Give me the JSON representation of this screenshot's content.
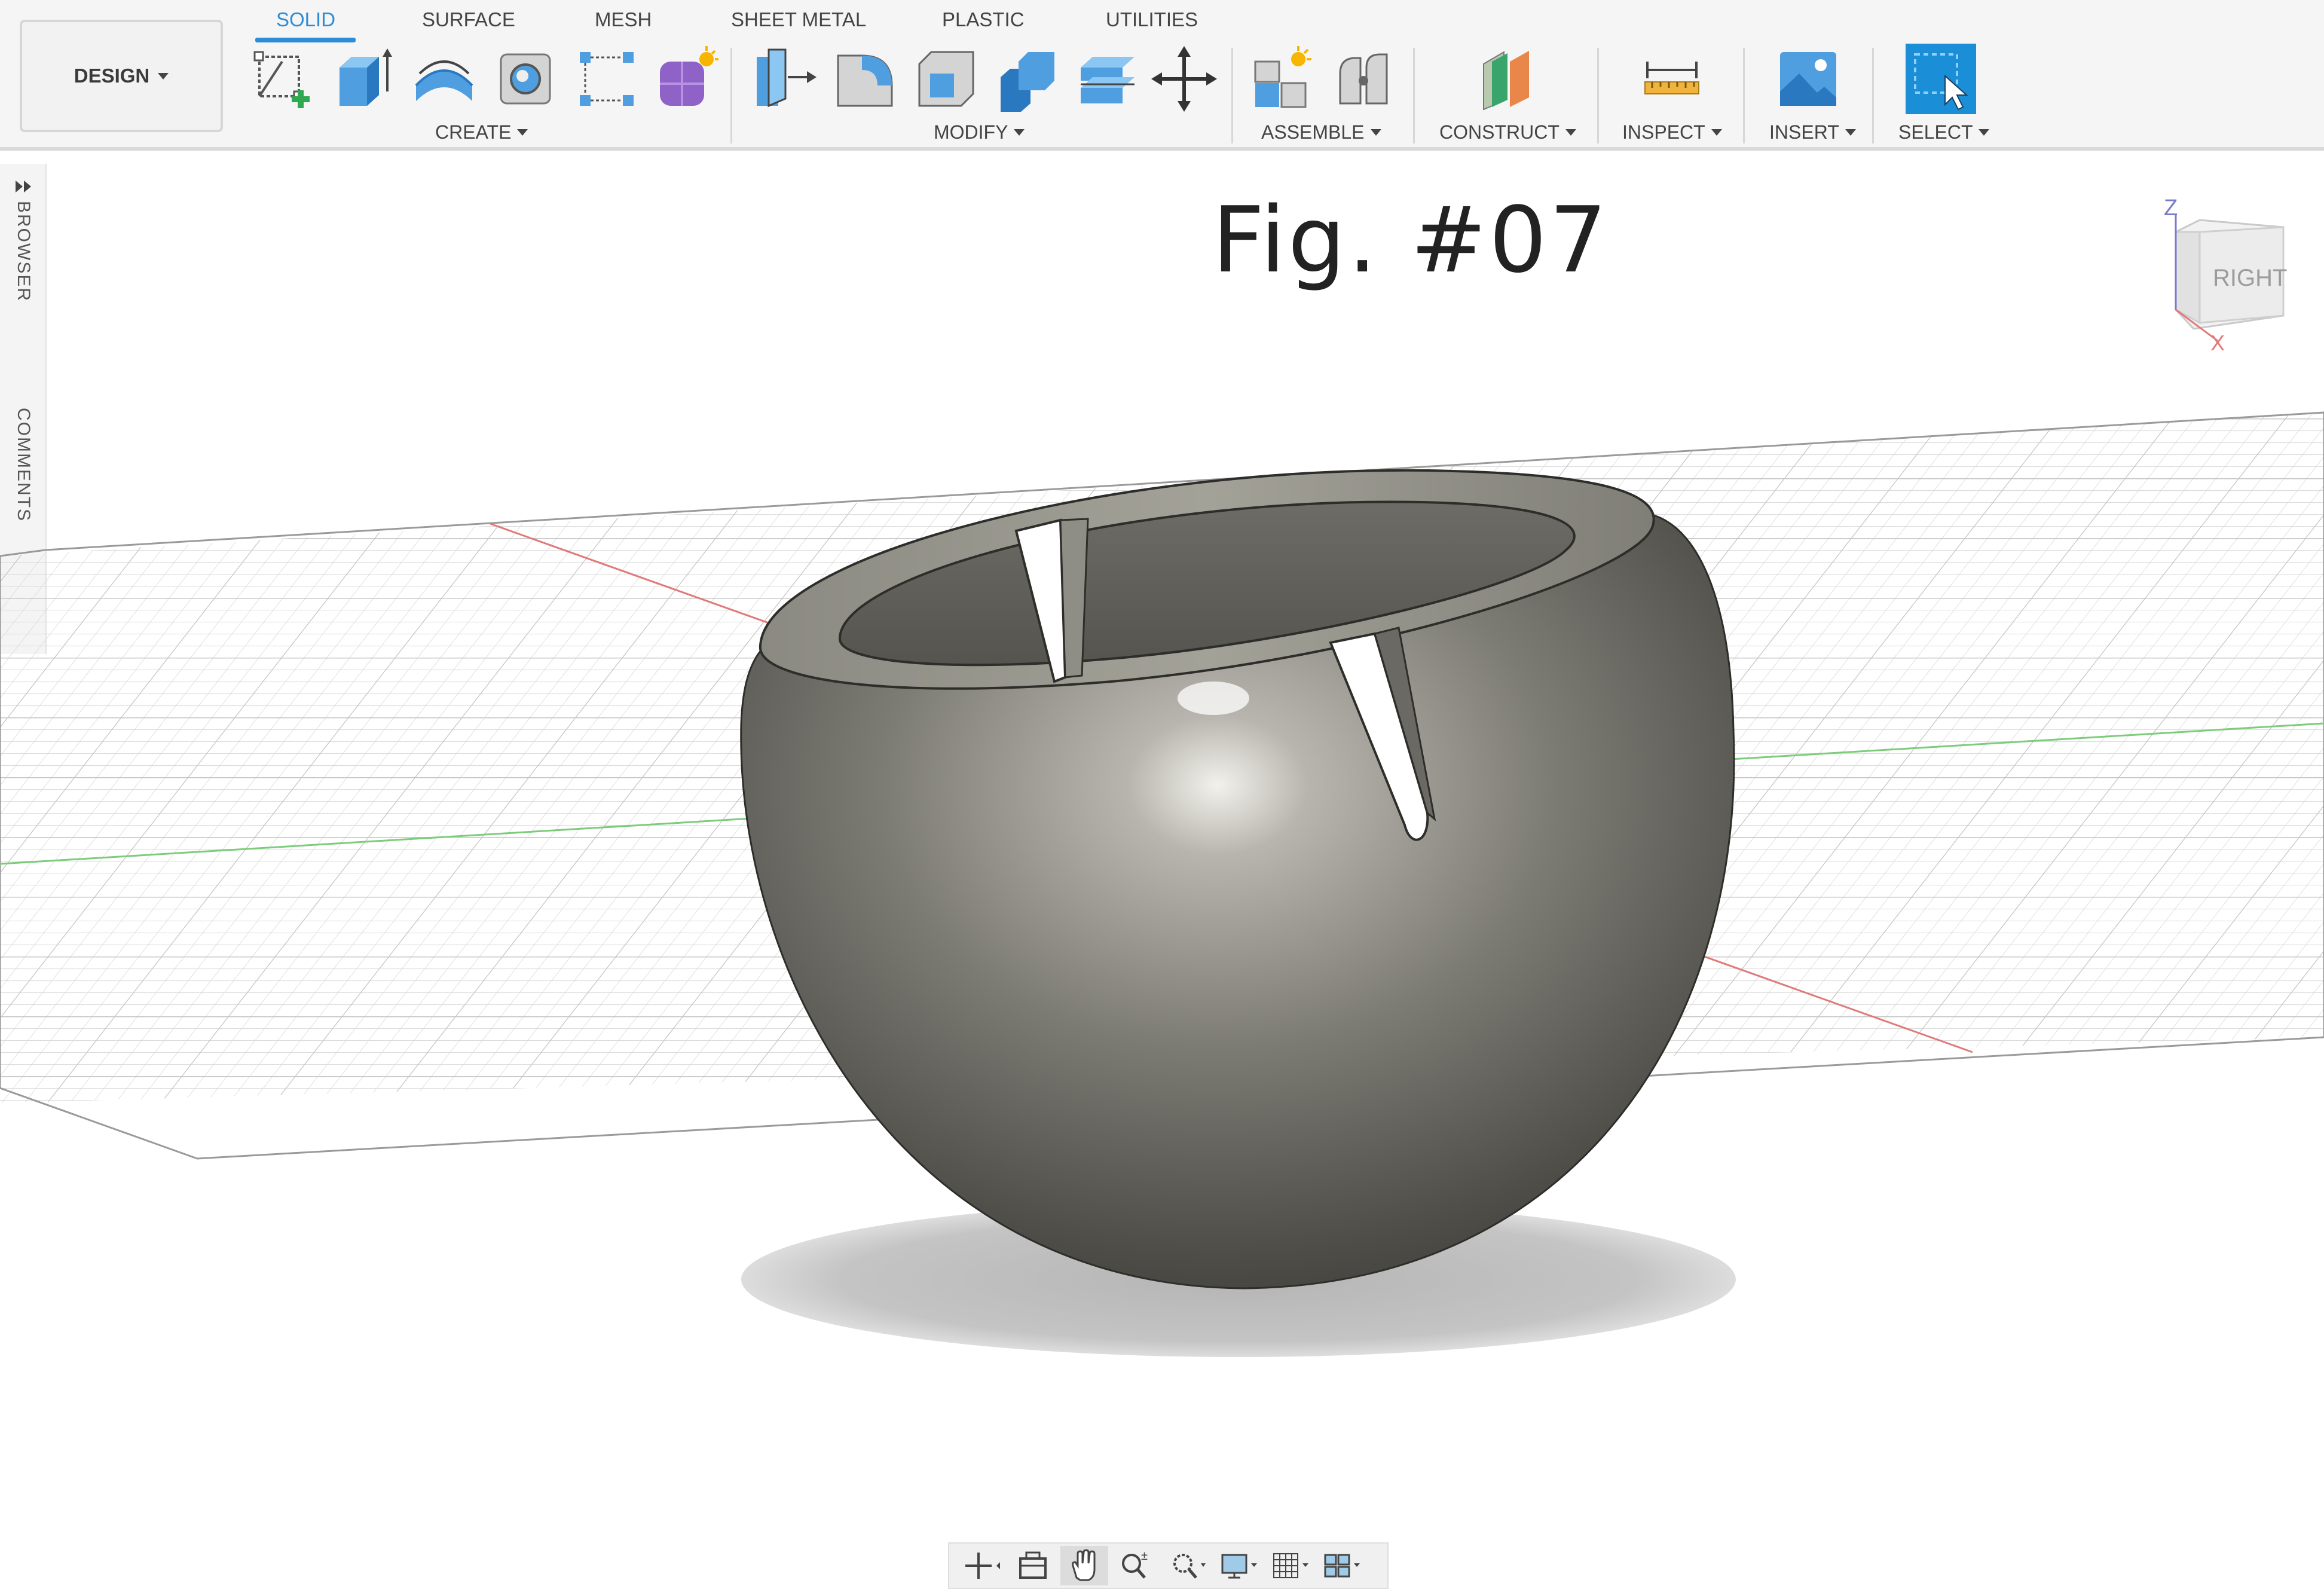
{
  "toolbar": {
    "workspace_label": "DESIGN",
    "tabs": [
      {
        "label": "SOLID",
        "active": true
      },
      {
        "label": "SURFACE"
      },
      {
        "label": "MESH"
      },
      {
        "label": "SHEET METAL"
      },
      {
        "label": "PLASTIC"
      },
      {
        "label": "UTILITIES"
      }
    ],
    "groups": {
      "create": "CREATE",
      "modify": "MODIFY",
      "assemble": "ASSEMBLE",
      "construct": "CONSTRUCT",
      "inspect": "INSPECT",
      "insert": "INSERT",
      "select": "SELECT"
    },
    "accent_color": "#2d8cd6"
  },
  "side_panel": {
    "browser_label": "BROWSER",
    "comments_label": "COMMENTS"
  },
  "viewport": {
    "figure_title": "Fig.  #07",
    "viewcube": {
      "face_label": "RIGHT",
      "axis_z": "Z",
      "axis_x": "X"
    },
    "body_color": "#6e6d68"
  },
  "navigation_bar": {
    "icons": [
      "orbit-icon",
      "look-at-icon",
      "pan-icon",
      "zoom-icon",
      "fit-icon",
      "display-settings-icon",
      "grid-icon",
      "viewports-icon"
    ]
  }
}
